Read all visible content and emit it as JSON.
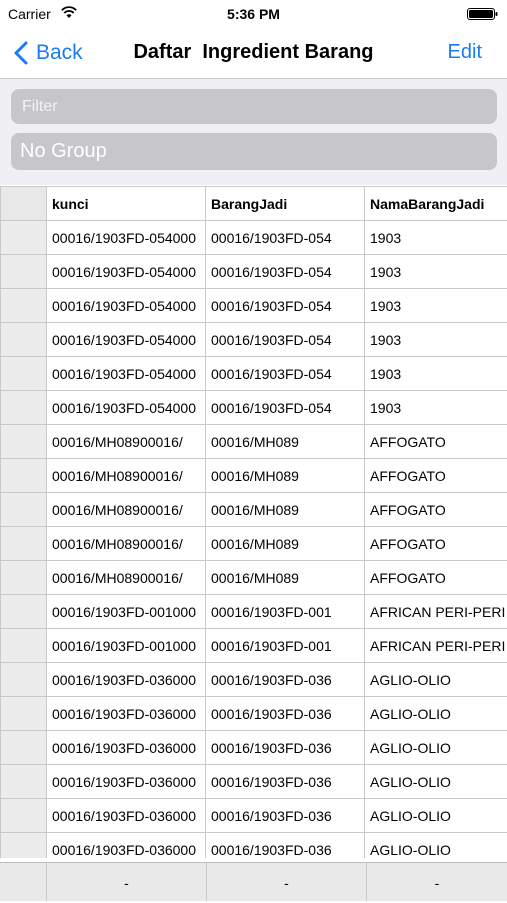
{
  "status": {
    "carrier": "Carrier",
    "time": "5:36 PM"
  },
  "nav": {
    "back_label": "Back",
    "title": "Daftar  Ingredient Barang",
    "edit_label": "Edit"
  },
  "filter": {
    "placeholder": "Filter",
    "group_label": "No Group"
  },
  "table": {
    "columns": [
      "kunci",
      "BarangJadi",
      "NamaBarangJadi"
    ],
    "rows": [
      [
        "00016/1903FD-054000",
        "00016/1903FD-054",
        "1903"
      ],
      [
        "00016/1903FD-054000",
        "00016/1903FD-054",
        "1903"
      ],
      [
        "00016/1903FD-054000",
        "00016/1903FD-054",
        "1903"
      ],
      [
        "00016/1903FD-054000",
        "00016/1903FD-054",
        "1903"
      ],
      [
        "00016/1903FD-054000",
        "00016/1903FD-054",
        "1903"
      ],
      [
        "00016/1903FD-054000",
        "00016/1903FD-054",
        "1903"
      ],
      [
        "00016/MH08900016/",
        "00016/MH089",
        "AFFOGATO"
      ],
      [
        "00016/MH08900016/",
        "00016/MH089",
        "AFFOGATO"
      ],
      [
        "00016/MH08900016/",
        "00016/MH089",
        "AFFOGATO"
      ],
      [
        "00016/MH08900016/",
        "00016/MH089",
        "AFFOGATO"
      ],
      [
        "00016/MH08900016/",
        "00016/MH089",
        "AFFOGATO"
      ],
      [
        "00016/1903FD-001000",
        "00016/1903FD-001",
        "AFRICAN PERI-PERI"
      ],
      [
        "00016/1903FD-001000",
        "00016/1903FD-001",
        "AFRICAN PERI-PERI"
      ],
      [
        "00016/1903FD-036000",
        "00016/1903FD-036",
        "AGLIO-OLIO"
      ],
      [
        "00016/1903FD-036000",
        "00016/1903FD-036",
        "AGLIO-OLIO"
      ],
      [
        "00016/1903FD-036000",
        "00016/1903FD-036",
        "AGLIO-OLIO"
      ],
      [
        "00016/1903FD-036000",
        "00016/1903FD-036",
        "AGLIO-OLIO"
      ],
      [
        "00016/1903FD-036000",
        "00016/1903FD-036",
        "AGLIO-OLIO"
      ],
      [
        "00016/1903FD-036000",
        "00016/1903FD-036",
        "AGLIO-OLIO"
      ]
    ],
    "footer": [
      "-",
      "-",
      "-"
    ]
  },
  "colors": {
    "accent": "#1a7cf5",
    "field_bg": "#c6c6cb",
    "filter_bg": "#efeff4"
  },
  "icons": {
    "back": "chevron-left-icon",
    "wifi": "wifi-icon",
    "battery": "battery-icon"
  }
}
